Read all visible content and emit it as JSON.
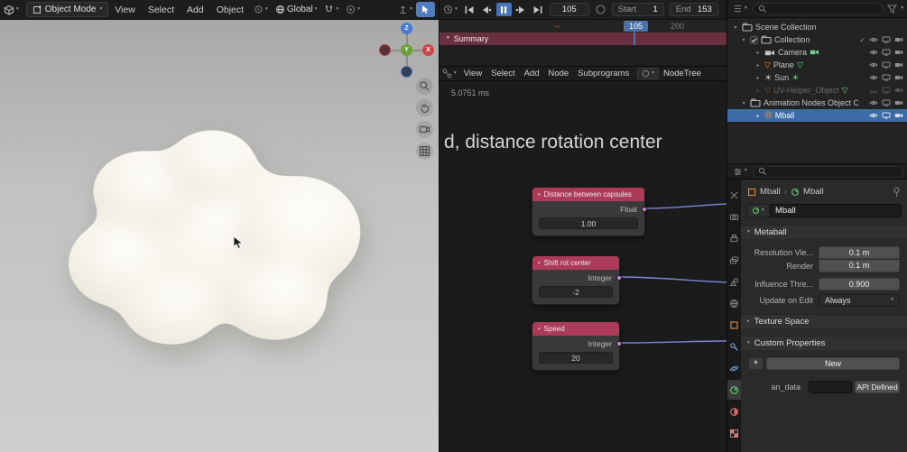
{
  "icons": {
    "caret": "▾",
    "disc_open": "▾",
    "disc_closed": "▸",
    "tri_down": "▽",
    "sun": "☀",
    "arrows_lr": "↔",
    "check": "✓",
    "plus": "+",
    "chevron": "›",
    "meta_ring": "◎"
  },
  "viewport": {
    "mode": "Object Mode",
    "menus": [
      "View",
      "Select",
      "Add",
      "Object"
    ],
    "orientation": "Global",
    "gizmo": {
      "x": "X",
      "y": "Y",
      "z": "Z"
    }
  },
  "timeline": {
    "frame": "105",
    "start_label": "Start",
    "start": "1",
    "end_label": "End",
    "end": "153",
    "ruler_current": "105",
    "ruler_tick": "200",
    "summary": "Summary"
  },
  "node_editor": {
    "menus": [
      "View",
      "Select",
      "Add",
      "Node",
      "Subprograms"
    ],
    "tree": "NodeTree",
    "exec_time": "5.0751 ms",
    "frame_title": "d, distance rotation center",
    "nodes": [
      {
        "title": "Distance between capsules",
        "output": "Float",
        "value": "1.00"
      },
      {
        "title": "Shift rot center",
        "output": "Integer",
        "value": "-2"
      },
      {
        "title": "Speed",
        "output": "Integer",
        "value": "20"
      }
    ]
  },
  "outliner": {
    "rows": [
      {
        "label": "Scene Collection"
      },
      {
        "label": "Collection"
      },
      {
        "label": "Camera"
      },
      {
        "label": "Plane"
      },
      {
        "label": "Sun"
      },
      {
        "label": "UV-Helper_Object"
      },
      {
        "label": "Animation Nodes Object Con..."
      },
      {
        "label": "Mball"
      }
    ]
  },
  "properties": {
    "breadcrumb_object": "Mball",
    "breadcrumb_data": "Mball",
    "datablock_name": "Mball",
    "metaball": {
      "title": "Metaball",
      "rows": [
        {
          "label": "Resolution Vie...",
          "value": "0.1 m"
        },
        {
          "label": "Render",
          "value": "0.1 m"
        },
        {
          "label": "Influence Thre...",
          "value": "0.900"
        },
        {
          "label": "Update on Edit",
          "value": "Always"
        }
      ]
    },
    "texture_space_title": "Texture Space",
    "custom_properties_title": "Custom Properties",
    "new_button": "New",
    "prop_name": "an_data",
    "api_defined_button": "API Defined"
  }
}
